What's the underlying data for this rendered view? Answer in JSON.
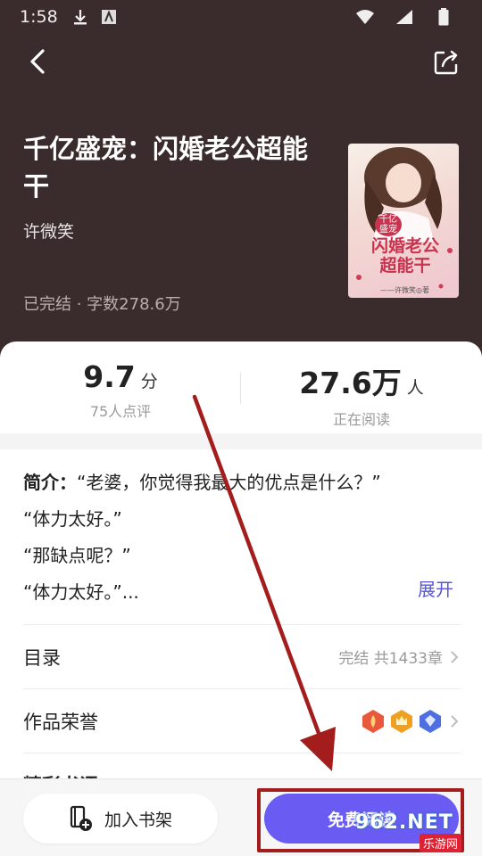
{
  "status_bar": {
    "time": "1:58"
  },
  "header": {
    "title": "千亿盛宠：闪婚老公超能干",
    "author": "许微笑",
    "meta": "已完结 · 字数278.6万"
  },
  "cover": {
    "line1": "千亿",
    "line2": "盛宠",
    "line3": "闪婚老公",
    "line4": "超能干",
    "author_tag": "——许微笑◎著"
  },
  "stats": {
    "score_value": "9.7",
    "score_unit": "分",
    "score_sub": "75人点评",
    "readers_value": "27.6万",
    "readers_unit": "人",
    "readers_sub": "正在阅读"
  },
  "intro": {
    "label": "简介：",
    "line1": "“老婆，你觉得我最大的优点是什么？”",
    "line2": "“体力太好。”",
    "line3": "“那缺点呢？”",
    "line4": "“体力太好。”...",
    "expand_label": "展开"
  },
  "catalog": {
    "label": "目录",
    "right_text": "完结 共1433章"
  },
  "honors": {
    "label": "作品荣誉"
  },
  "peek_label": "精彩书评",
  "bottom": {
    "shelf_label": "加入书架",
    "read_label": "免费阅读"
  },
  "watermark": {
    "main": "962.NET",
    "sub": "乐游网"
  },
  "colors": {
    "header_bg": "#3a2c2c",
    "accent": "#6a5cf2",
    "annotation_red": "#a41d1d"
  }
}
